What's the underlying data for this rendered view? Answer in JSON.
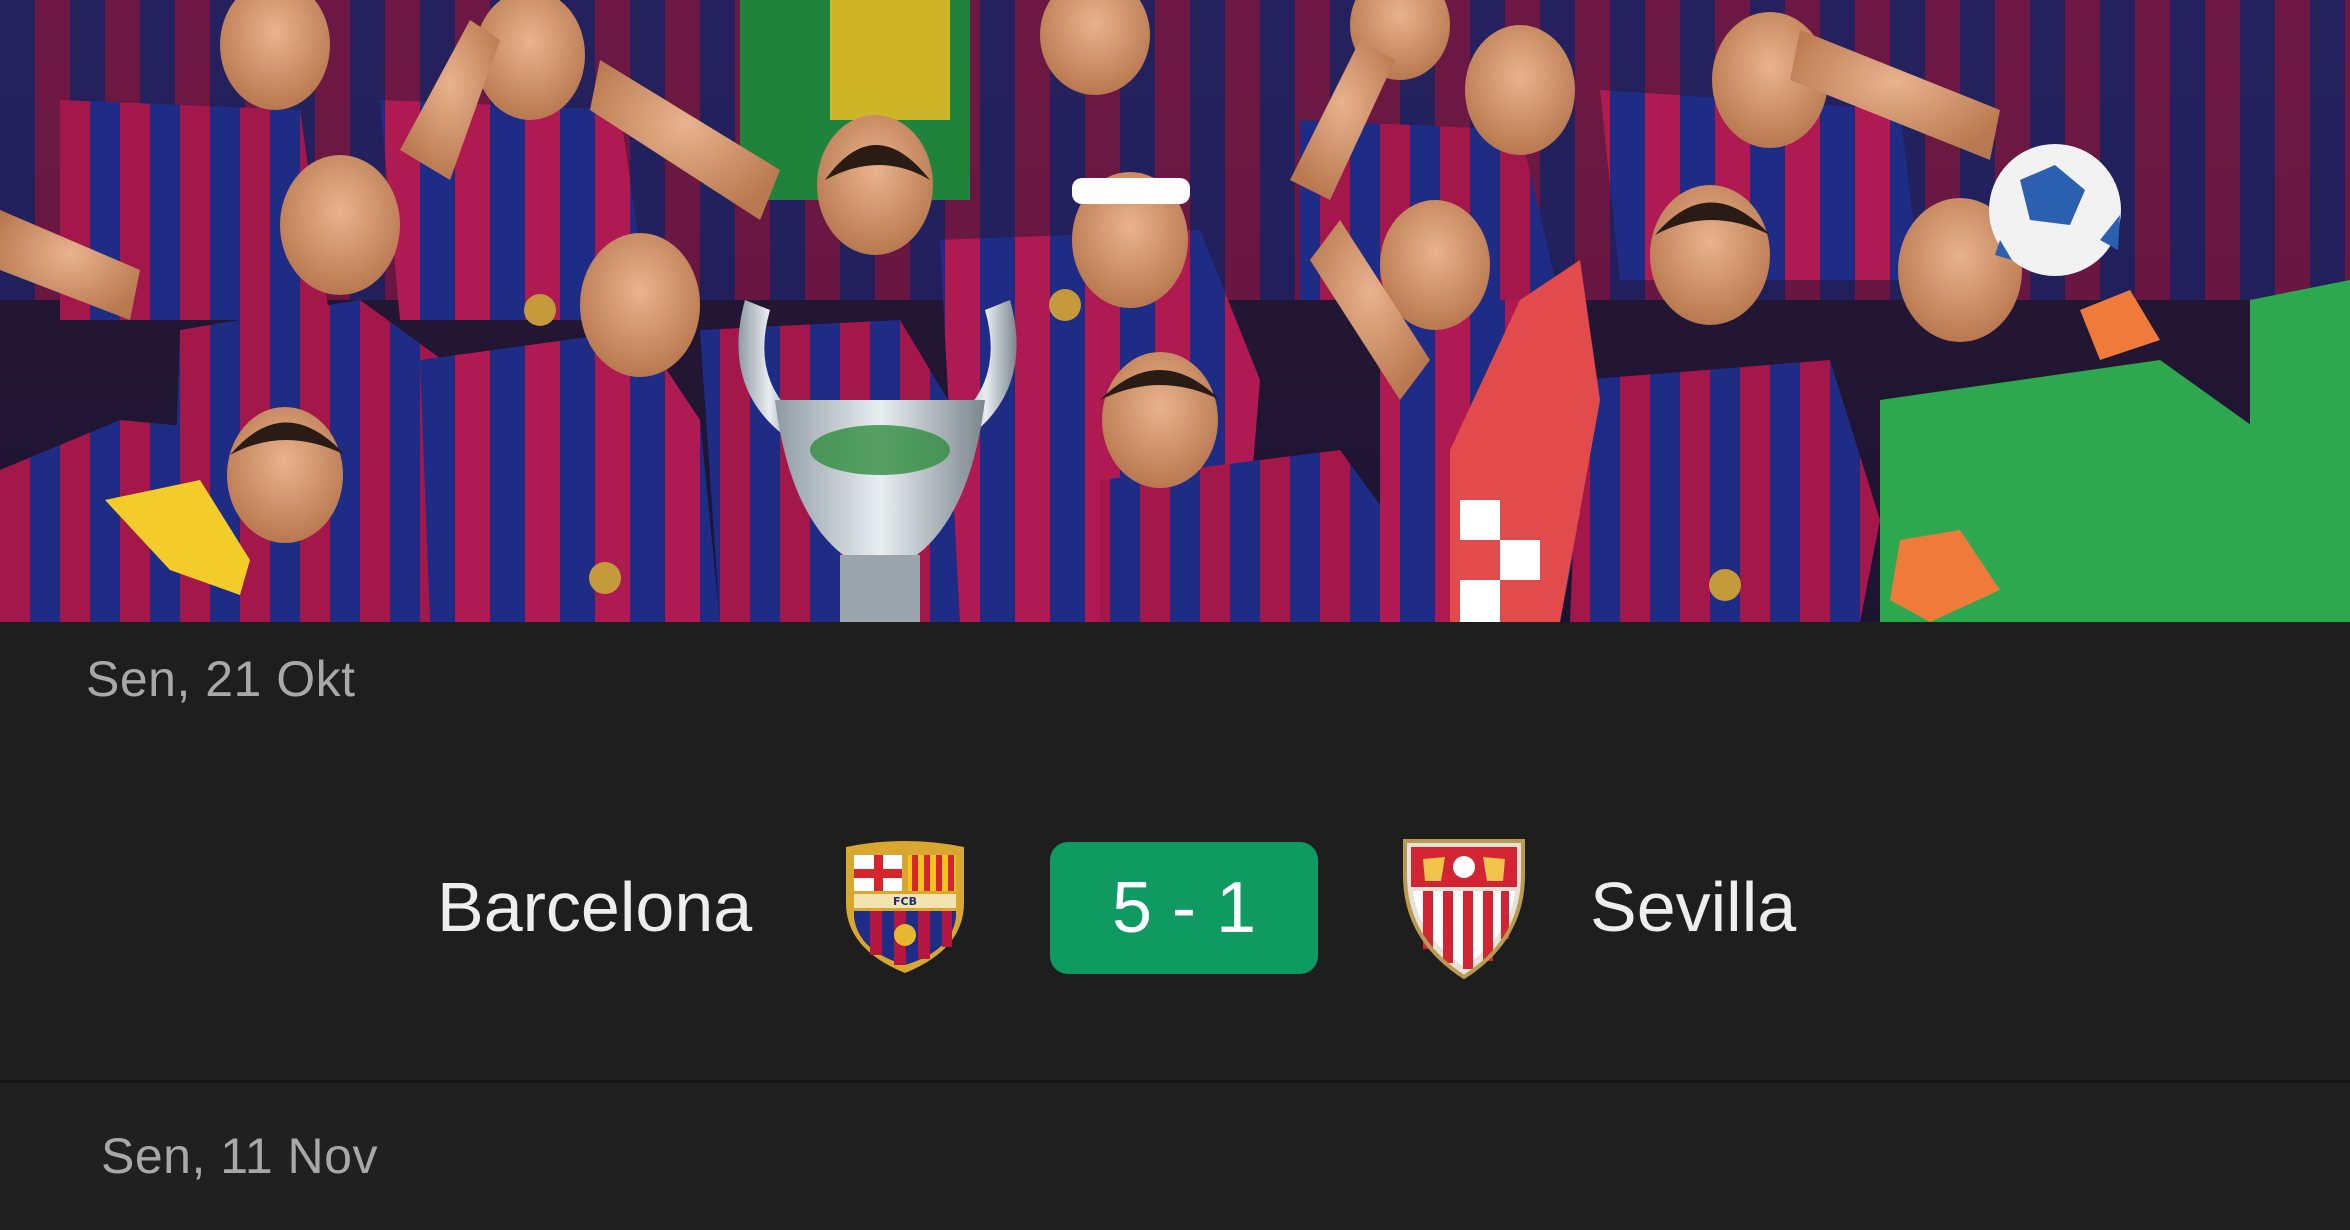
{
  "hero": {
    "image": "barcelona-champions-league-celebration-photo",
    "colors": {
      "blaugrana_red": "#a3174a",
      "blaugrana_blue": "#1f2c86",
      "keeper_green": "#2ea84f"
    }
  },
  "matches": [
    {
      "date": "Sen, 21 Okt",
      "home_team": "Barcelona",
      "home_crest": "barcelona-crest-icon",
      "score": "5 - 1",
      "away_team": "Sevilla",
      "away_crest": "sevilla-crest-icon",
      "score_color": "#0f9a61"
    },
    {
      "date": "Sen, 11 Nov"
    }
  ]
}
